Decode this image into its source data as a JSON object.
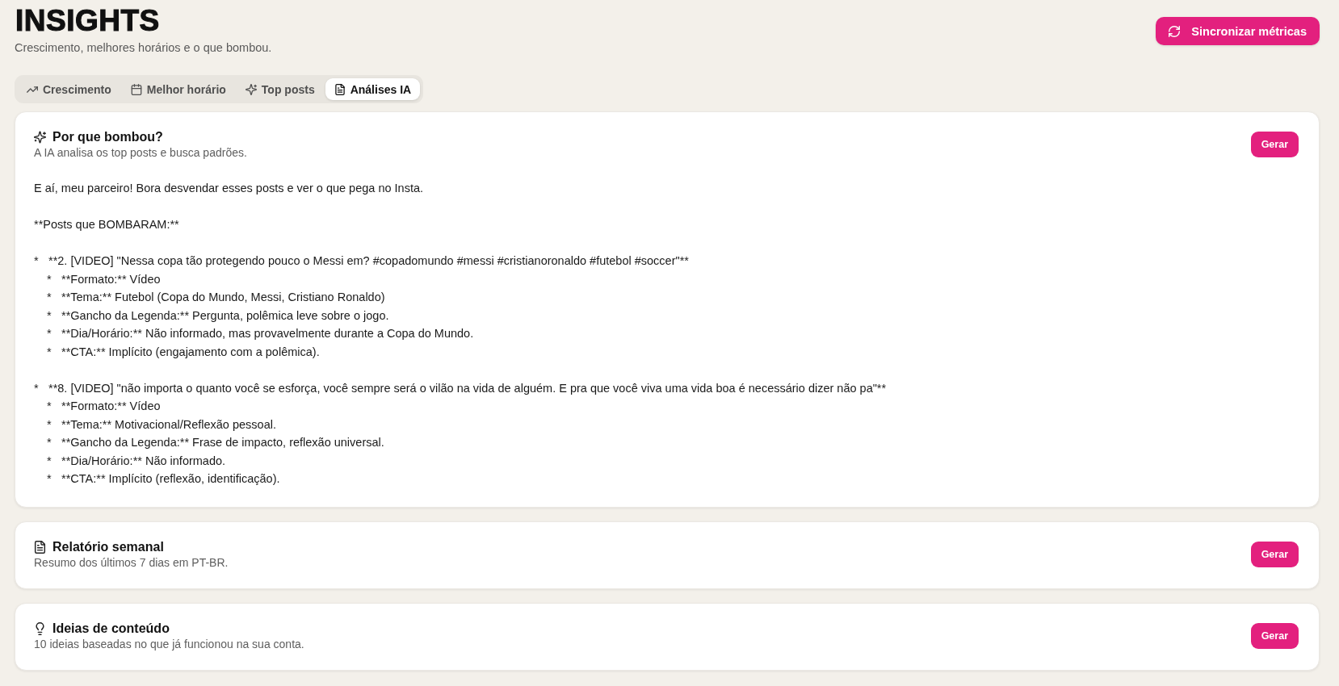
{
  "header": {
    "title": "INSIGHTS",
    "subtitle": "Crescimento, melhores horários e o que bombou.",
    "sync_button": "Sincronizar métricas"
  },
  "tabs": [
    {
      "label": "Crescimento",
      "selected": false
    },
    {
      "label": "Melhor horário",
      "selected": false
    },
    {
      "label": "Top posts",
      "selected": false
    },
    {
      "label": "Análises IA",
      "selected": true
    }
  ],
  "cards": [
    {
      "title": "Por que bombou?",
      "subtitle": "A IA analisa os top posts e busca padrões.",
      "button": "Gerar",
      "result": [
        {
          "kind": "paragraph",
          "text": "E aí, meu parceiro! Bora desvendar esses posts e ver o que pega no Insta."
        },
        {
          "kind": "paragraph",
          "text": "**Posts que BOMBARAM:**"
        },
        {
          "kind": "bullet",
          "bullet": "*",
          "text": "**2. [VIDEO] \"Nessa copa tão protegendo pouco o Messi em? #copadomundo #messi #cristianoronaldo #futebol #soccer\"**",
          "children": [
            {
              "bullet": "*",
              "text": "**Formato:** Vídeo"
            },
            {
              "bullet": "*",
              "text": "**Tema:** Futebol (Copa do Mundo, Messi, Cristiano Ronaldo)"
            },
            {
              "bullet": "*",
              "text": "**Gancho da Legenda:** Pergunta, polêmica leve sobre o jogo."
            },
            {
              "bullet": "*",
              "text": "**Dia/Horário:** Não informado, mas provavelmente durante a Copa do Mundo."
            },
            {
              "bullet": "*",
              "text": "**CTA:** Implícito (engajamento com a polêmica)."
            }
          ]
        },
        {
          "kind": "bullet",
          "bullet": "*",
          "text": "**8. [VIDEO] \"não importa o quanto você se esforça, você sempre será o vilão na vida de alguém. E pra que você viva uma vida boa é necessário dizer não pa\"**",
          "children": [
            {
              "bullet": "*",
              "text": "**Formato:** Vídeo"
            },
            {
              "bullet": "*",
              "text": "**Tema:** Motivacional/Reflexão pessoal."
            },
            {
              "bullet": "*",
              "text": "**Gancho da Legenda:** Frase de impacto, reflexão universal."
            },
            {
              "bullet": "*",
              "text": "**Dia/Horário:** Não informado."
            },
            {
              "bullet": "*",
              "text": "**CTA:** Implícito (reflexão, identificação)."
            }
          ]
        }
      ]
    },
    {
      "title": "Relatório semanal",
      "subtitle": "Resumo dos últimos 7 dias em PT-BR.",
      "button": "Gerar"
    },
    {
      "title": "Ideias de conteúdo",
      "subtitle": "10 ideias baseadas no que já funcionou na sua conta.",
      "button": "Gerar"
    }
  ]
}
